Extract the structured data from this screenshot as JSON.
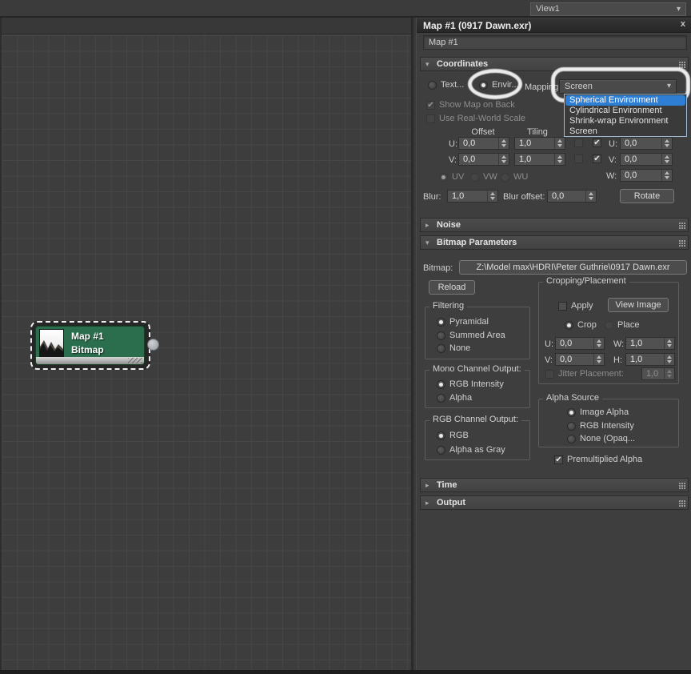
{
  "toolbar": {
    "view_tab": "View1"
  },
  "icons": {
    "check": "✔",
    "chevron_down": "▾",
    "arrow_expanded": "▾",
    "arrow_collapsed": "▸"
  },
  "panel": {
    "title": "Map #1 (0917 Dawn.exr)",
    "close": "x",
    "name_field": "Map #1"
  },
  "rollouts": {
    "coordinates": "Coordinates",
    "noise": "Noise",
    "bitmap_parameters": "Bitmap Parameters",
    "time": "Time",
    "output": "Output"
  },
  "coordinates": {
    "texture_label": "Text...",
    "environ_label": "Envir...",
    "mapping_label": "Mapping:",
    "mapping_value": "Screen",
    "dropdown_options": [
      "Spherical Environment",
      "Cylindrical Environment",
      "Shrink-wrap Environment",
      "Screen"
    ],
    "dropdown_highlighted": "Spherical Environment",
    "show_map_on_back": "Show Map on Back",
    "use_real_world_scale": "Use Real-World Scale",
    "offset_header": "Offset",
    "tiling_header": "Tiling",
    "u_label": "U:",
    "v_label": "V:",
    "w_label": "W:",
    "offset_u": "0,0",
    "offset_v": "0,0",
    "tiling_u": "1,0",
    "tiling_v": "1,0",
    "angle_u": "0,0",
    "angle_v": "0,0",
    "angle_w": "0,0",
    "uv": "UV",
    "vw": "VW",
    "wu": "WU",
    "blur_label": "Blur:",
    "blur_value": "1,0",
    "blur_offset_label": "Blur offset:",
    "blur_offset_value": "0,0",
    "rotate_button": "Rotate"
  },
  "bitmap_params": {
    "bitmap_label": "Bitmap:",
    "bitmap_path": "Z:\\Model max\\HDRI\\Peter Guthrie\\0917 Dawn.exr",
    "reload_button": "Reload",
    "filtering": {
      "title": "Filtering",
      "options": [
        "Pyramidal",
        "Summed Area",
        "None"
      ],
      "selected": "Pyramidal"
    },
    "mono_channel": {
      "title": "Mono Channel Output:",
      "options": [
        "RGB Intensity",
        "Alpha"
      ],
      "selected": "RGB Intensity"
    },
    "rgb_channel": {
      "title": "RGB Channel Output:",
      "options": [
        "RGB",
        "Alpha as Gray"
      ],
      "selected": "RGB"
    },
    "cropping": {
      "title": "Cropping/Placement",
      "apply_label": "Apply",
      "view_image_button": "View Image",
      "crop_label": "Crop",
      "place_label": "Place",
      "u_label": "U:",
      "u": "0,0",
      "w_label": "W:",
      "w": "1,0",
      "v_label": "V:",
      "v": "0,0",
      "h_label": "H:",
      "h": "1,0",
      "jitter_label": "Jitter Placement:",
      "jitter": "1,0"
    },
    "alpha_source": {
      "title": "Alpha Source",
      "options": [
        "Image Alpha",
        "RGB Intensity",
        "None (Opaq..."
      ],
      "selected": "Image Alpha"
    },
    "premultiplied_alpha": "Premultiplied Alpha"
  },
  "node": {
    "title": "Map #1",
    "subtitle": "Bitmap"
  },
  "colors": {
    "accent_blue": "#2e7fd4",
    "node_green": "#2a6e4d",
    "annotation_white": "#fafafa"
  }
}
